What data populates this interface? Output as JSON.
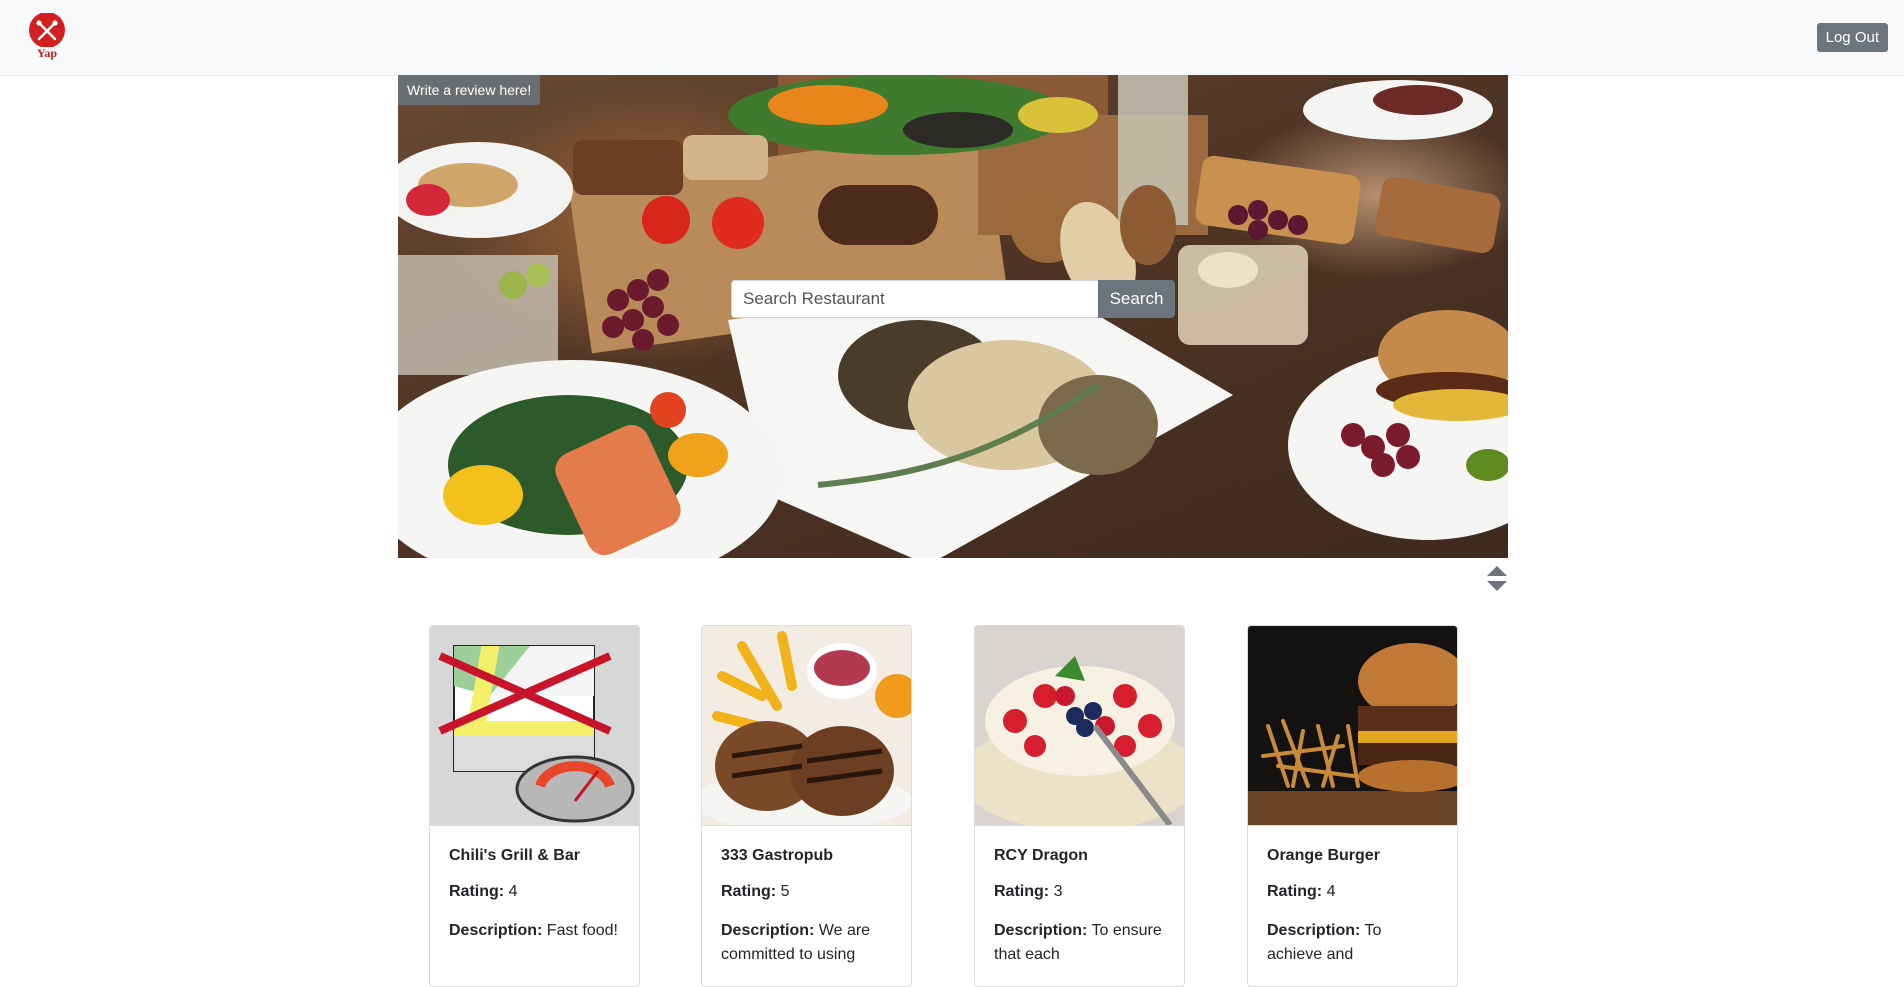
{
  "brand": {
    "name": "Yap",
    "color": "#d21f1f"
  },
  "nav": {
    "logout_label": "Log Out"
  },
  "hero": {
    "review_link": "Write a review here!",
    "search_placeholder": "Search Restaurant",
    "search_button": "Search"
  },
  "labels": {
    "rating": "Rating:",
    "description": "Description:"
  },
  "restaurants": [
    {
      "name": "Chili's Grill & Bar",
      "rating": "4",
      "description": "Fast food!",
      "image": "map-unavailable"
    },
    {
      "name": "333 Gastropub",
      "rating": "5",
      "description": "We are committed to using",
      "image": "grilled-patties-fries"
    },
    {
      "name": "RCY Dragon",
      "rating": "3",
      "description": "To ensure that each",
      "image": "berry-cake"
    },
    {
      "name": "Orange Burger",
      "rating": "4",
      "description": "To achieve and",
      "image": "burger-fries"
    }
  ]
}
